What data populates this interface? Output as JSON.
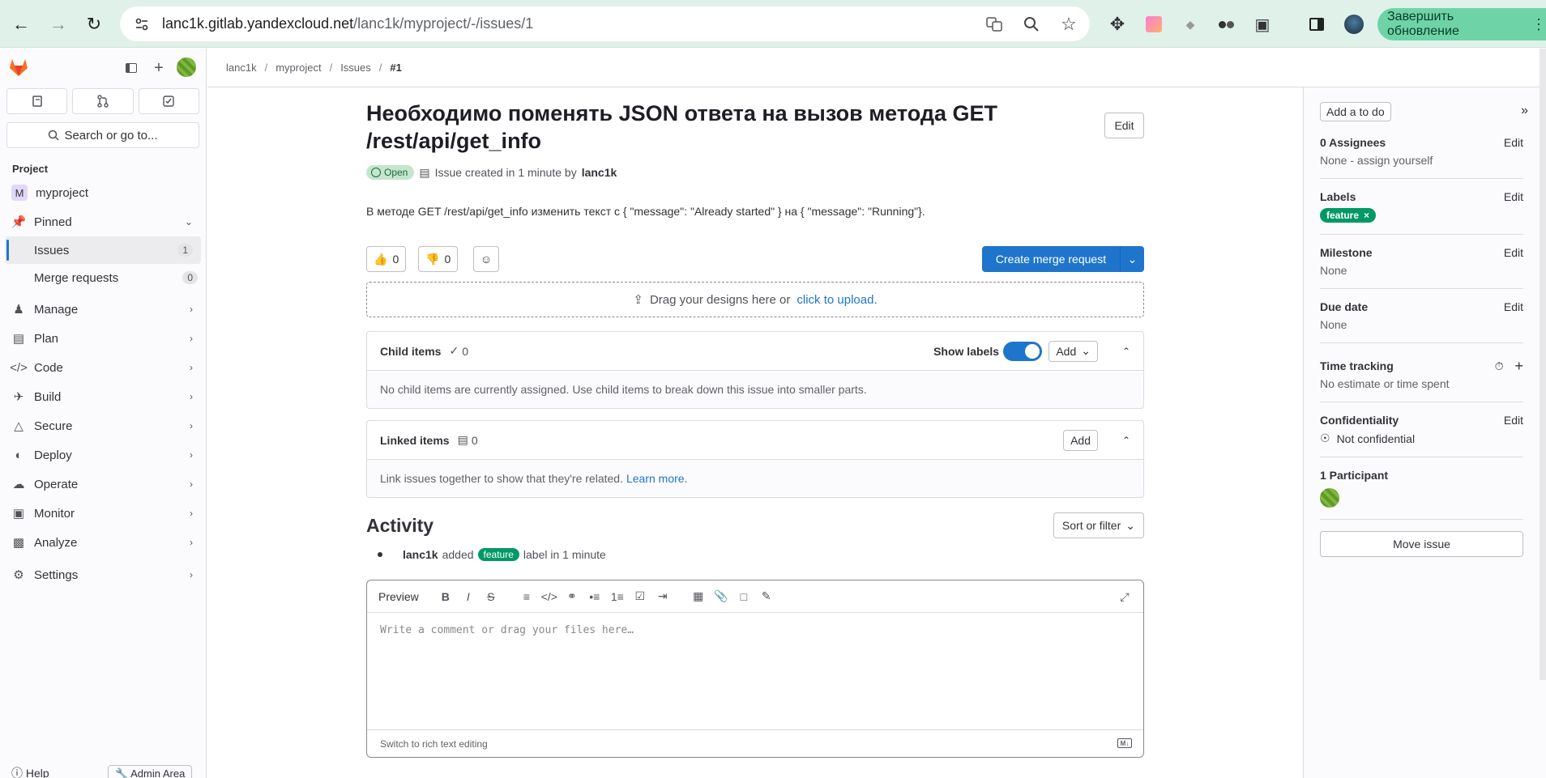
{
  "browser": {
    "url_host": "lanc1k.gitlab.yandexcloud.net",
    "url_path": "/lanc1k/myproject/-/issues/1",
    "update_button": "Завершить обновление"
  },
  "sidebar": {
    "search": "Search or go to...",
    "section": "Project",
    "project_initial": "M",
    "project_name": "myproject",
    "pinned": "Pinned",
    "items": [
      {
        "label": "Issues",
        "count": "1"
      },
      {
        "label": "Merge requests",
        "count": "0"
      }
    ],
    "menu": [
      "Manage",
      "Plan",
      "Code",
      "Build",
      "Secure",
      "Deploy",
      "Operate",
      "Monitor",
      "Analyze",
      "Settings"
    ],
    "help": "Help",
    "admin": "Admin Area"
  },
  "breadcrumb": [
    "lanc1k",
    "myproject",
    "Issues",
    "#1"
  ],
  "issue": {
    "title": "Необходимо поменять JSON ответа на вызов метода GET /rest/api/get_info",
    "edit": "Edit",
    "status": "Open",
    "created_text": "Issue created in 1 minute by",
    "author": "lanc1k",
    "description": "В методе GET /rest/api/get_info изменить текст с { \"message\": \"Already started\" } на { \"message\": \"Running\"}.",
    "thumbs_up": "0",
    "thumbs_down": "0",
    "create_mr": "Create merge request",
    "upload_text": "Drag your designs here or",
    "upload_link": "click to upload."
  },
  "child_items": {
    "title": "Child items",
    "count": "0",
    "show_labels": "Show labels",
    "add": "Add",
    "empty": "No child items are currently assigned. Use child items to break down this issue into smaller parts."
  },
  "linked_items": {
    "title": "Linked items",
    "count": "0",
    "add": "Add",
    "empty": "Link issues together to show that they're related.",
    "learn_more": "Learn more."
  },
  "activity": {
    "title": "Activity",
    "sort": "Sort or filter",
    "event_user": "lanc1k",
    "event_action": "added",
    "event_label": "feature",
    "event_suffix": "label in 1 minute"
  },
  "comment": {
    "preview": "Preview",
    "placeholder": "Write a comment or drag your files here…",
    "switch": "Switch to rich text editing"
  },
  "right_sidebar": {
    "todo": "Add a to do",
    "assignees_title": "0 Assignees",
    "assignees_value": "None - assign yourself",
    "labels_title": "Labels",
    "label": "feature",
    "milestone_title": "Milestone",
    "milestone_value": "None",
    "due_title": "Due date",
    "due_value": "None",
    "time_title": "Time tracking",
    "time_value": "No estimate or time spent",
    "conf_title": "Confidentiality",
    "conf_value": "Not confidential",
    "participants_title": "1 Participant",
    "move": "Move issue",
    "edit": "Edit"
  },
  "colors": {
    "accent": "#1f75cb",
    "label": "#009966",
    "open": "#c3e6cd"
  }
}
